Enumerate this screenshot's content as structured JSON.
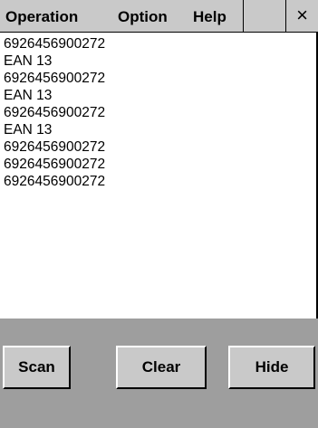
{
  "menu": {
    "operation": "Operation",
    "option": "Option",
    "help": "Help",
    "close": "×"
  },
  "output_lines": [
    "6926456900272",
    "EAN 13",
    "6926456900272",
    "EAN 13",
    "6926456900272",
    "EAN 13",
    "6926456900272",
    "6926456900272",
    "6926456900272"
  ],
  "buttons": {
    "scan": "Scan",
    "clear": "Clear",
    "hide": "Hide"
  },
  "colors": {
    "menubar": "#c9c9c9",
    "panel": "#9e9e9e",
    "button": "#c9c9c9"
  }
}
